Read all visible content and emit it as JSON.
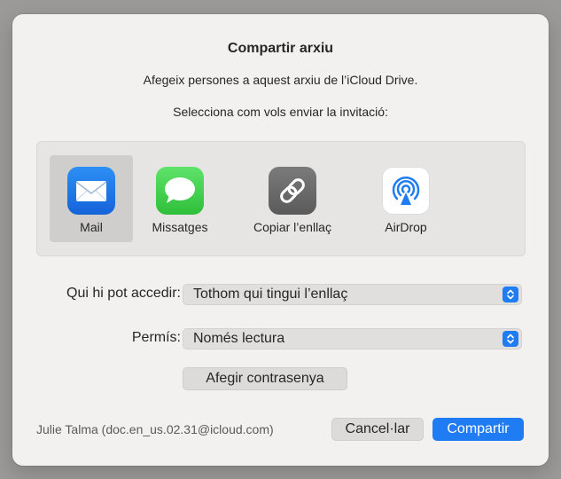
{
  "dialog": {
    "title": "Compartir arxiu",
    "subtitle": "Afegeix persones a aquest arxiu de l’iCloud Drive.",
    "instruction": "Selecciona com vols enviar la invitació:"
  },
  "share_options": [
    {
      "label": "Mail",
      "icon": "mail-icon",
      "selected": true
    },
    {
      "label": "Missatges",
      "icon": "messages-icon",
      "selected": false
    },
    {
      "label": "Copiar l’enllaç",
      "icon": "link-icon",
      "selected": false
    },
    {
      "label": "AirDrop",
      "icon": "airdrop-icon",
      "selected": false
    }
  ],
  "access": {
    "label": "Qui hi pot accedir:",
    "value": "Tothom qui tingui l’enllaç"
  },
  "permission": {
    "label": "Permís:",
    "value": "Només lectura"
  },
  "buttons": {
    "add_password": "Afegir contrasenya",
    "cancel": "Cancel·lar",
    "share": "Compartir"
  },
  "account": "Julie Talma (doc.en_us.02.31@icloud.com)",
  "colors": {
    "accent": "#1f7cf2",
    "background": "#f2f1ef"
  }
}
